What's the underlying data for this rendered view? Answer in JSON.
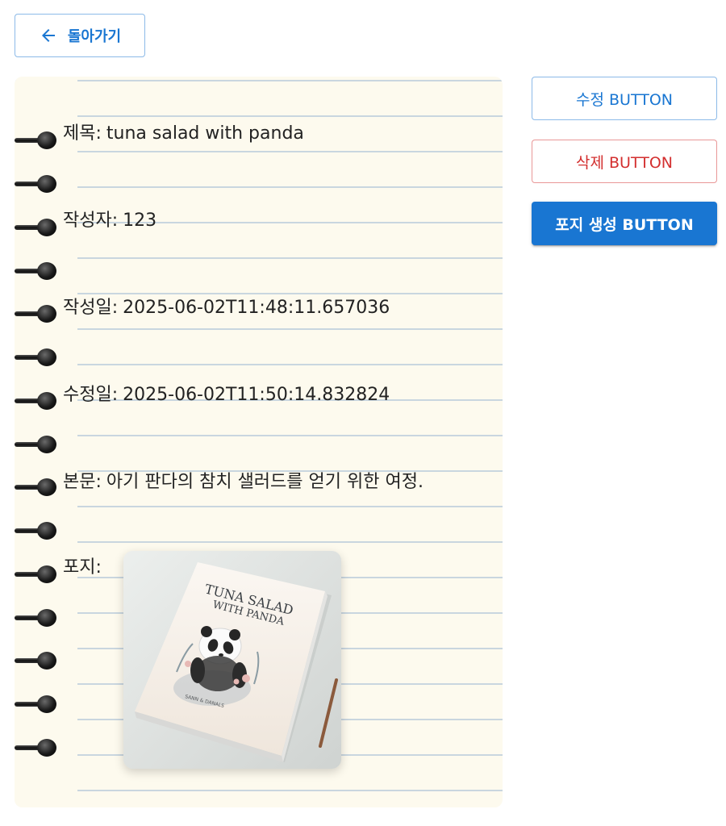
{
  "back": {
    "label": "돌아가기"
  },
  "post": {
    "title_label": "제목:",
    "title": "tuna salad with panda",
    "author_label": "작성자:",
    "author": "123",
    "created_label": "작성일:",
    "created": "2025-06-02T11:48:11.657036",
    "updated_label": "수정일:",
    "updated": "2025-06-02T11:50:14.832824",
    "body_label": "본문:",
    "body": "아기 판다의 참치 샐러드를 얻기 위한 여정.",
    "cover_label": "포지:"
  },
  "cover_image": {
    "book_title_line1": "TUNA SALAD",
    "book_title_line2": "WITH PANDA",
    "author_line": "SANN & DANALS"
  },
  "actions": {
    "edit": "수정 BUTTON",
    "delete": "삭제 BUTTON",
    "generate_cover": "포지 생성 BUTTON"
  },
  "colors": {
    "primary": "#1976d2",
    "danger": "#d32f2f",
    "paper": "#fdfaee",
    "rule_line": "#c9d6df"
  },
  "icons": {
    "back": "arrow-left-icon",
    "binding": "spiral-ring-icon"
  }
}
